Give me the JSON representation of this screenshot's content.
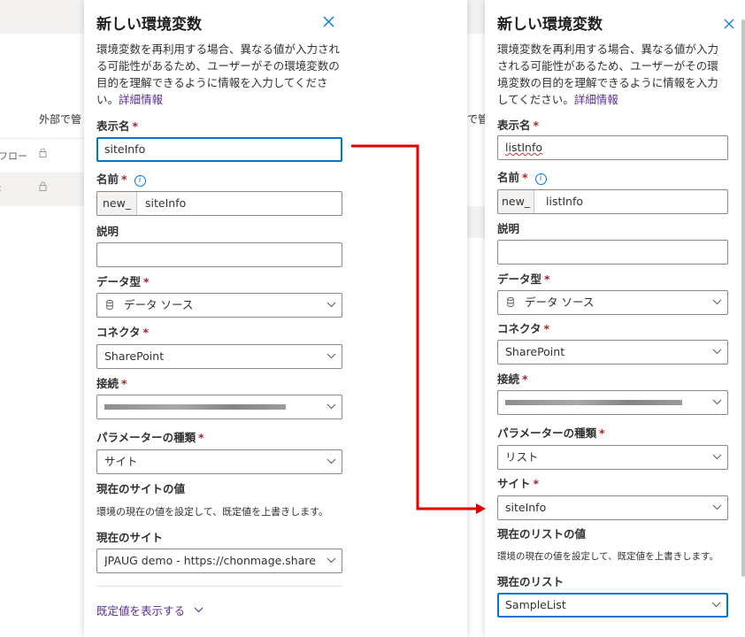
{
  "background": {
    "left_header": "外部で管",
    "left_row1_text": "フロー",
    "left_row2_text": "",
    "mid_header": "で管"
  },
  "panel1": {
    "title": "新しい環境変数",
    "description": "環境変数を再利用する場合、異なる値が入力される可能性があるため、ユーザーがその環境変数の目的を理解できるように情報を入力してください。",
    "more_info_link": "詳細情報",
    "display_name": {
      "label": "表示名",
      "required": "*",
      "value": "siteInfo"
    },
    "name": {
      "label": "名前",
      "required": "*",
      "prefix": "new_",
      "value": "siteInfo"
    },
    "description_field": {
      "label": "説明",
      "value": ""
    },
    "data_type": {
      "label": "データ型",
      "required": "*",
      "value": "データ ソース"
    },
    "connector": {
      "label": "コネクタ",
      "required": "*",
      "value": "SharePoint"
    },
    "connection": {
      "label": "接続",
      "required": "*",
      "value": ""
    },
    "parameter_type": {
      "label": "パラメーターの種類",
      "required": "*",
      "value": "サイト"
    },
    "current_value_heading": "現在のサイトの値",
    "current_value_note": "環境の現在の値を設定して、既定値を上書きします。",
    "current_site": {
      "label": "現在のサイト",
      "value": "JPAUG demo - https://chonmage.sharepo..."
    },
    "show_default": "既定値を表示する"
  },
  "panel2": {
    "title": "新しい環境変数",
    "description": "環境変数を再利用する場合、異なる値が入力される可能性があるため、ユーザーがその環境変数の目的を理解できるように情報を入力してください。",
    "more_info_link": "詳細情報",
    "display_name": {
      "label": "表示名",
      "required": "*",
      "value": "listInfo"
    },
    "name": {
      "label": "名前",
      "required": "*",
      "prefix": "new_",
      "value": "listInfo"
    },
    "description_field": {
      "label": "説明",
      "value": ""
    },
    "data_type": {
      "label": "データ型",
      "required": "*",
      "value": "データ ソース"
    },
    "connector": {
      "label": "コネクタ",
      "required": "*",
      "value": "SharePoint"
    },
    "connection": {
      "label": "接続",
      "required": "*",
      "value": ""
    },
    "parameter_type": {
      "label": "パラメーターの種類",
      "required": "*",
      "value": "リスト"
    },
    "site": {
      "label": "サイト",
      "required": "*",
      "value": "siteInfo"
    },
    "current_value_heading": "現在のリストの値",
    "current_value_note": "環境の現在の値を設定して、既定値を上書きします。",
    "current_list": {
      "label": "現在のリスト",
      "value": "SampleList"
    }
  },
  "colors": {
    "accent": "#0078d4",
    "required": "#a4262c",
    "link": "#5c2e91",
    "arrow": "#e00000"
  }
}
